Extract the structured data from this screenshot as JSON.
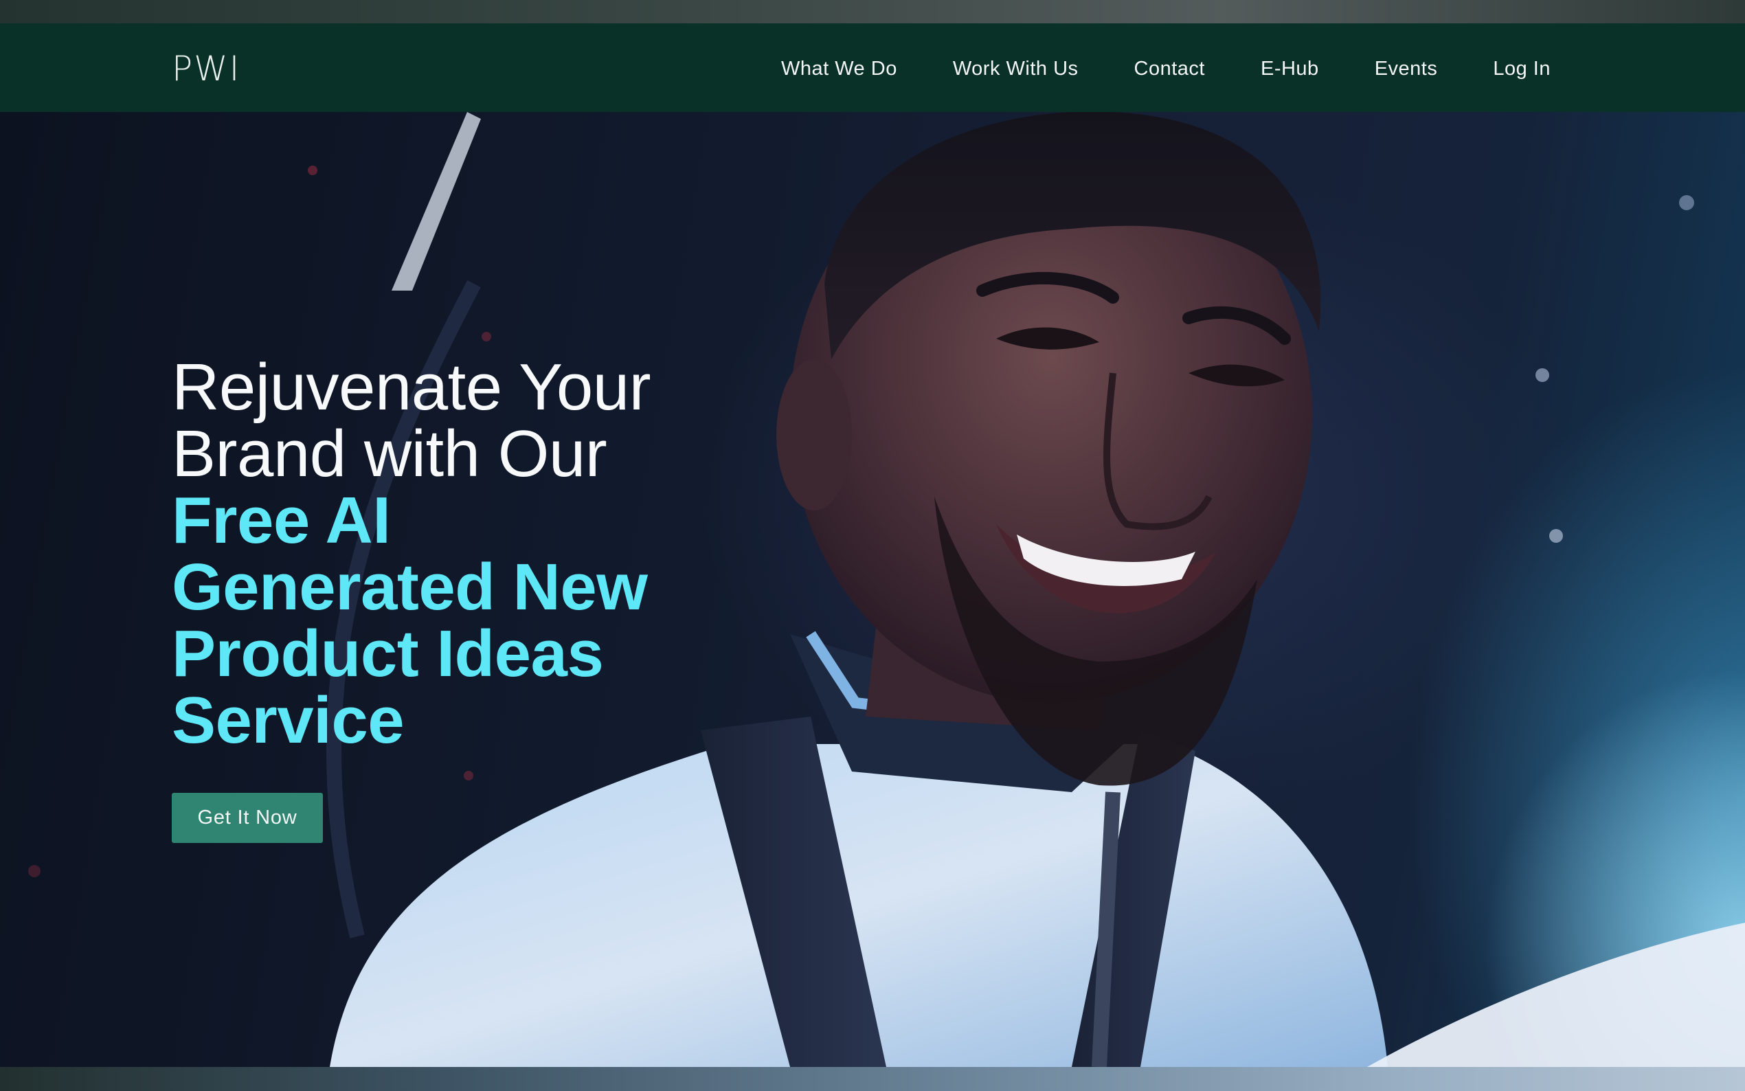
{
  "brand": {
    "logo_text": "PWI"
  },
  "nav": {
    "items": [
      {
        "label": "What We Do"
      },
      {
        "label": "Work With Us"
      },
      {
        "label": "Contact"
      },
      {
        "label": "E-Hub"
      },
      {
        "label": "Events"
      },
      {
        "label": "Log In"
      }
    ]
  },
  "hero": {
    "headline_white": [
      "Rejuvenate Your",
      "Brand with Our"
    ],
    "headline_cyan": [
      "Free AI",
      "Generated New",
      "Product Ideas",
      "Service"
    ],
    "cta_label": "Get It Now",
    "image_description_icon": "hero-portrait-image"
  },
  "colors": {
    "nav_background": "#0a3127",
    "accent_cyan": "#5ee7f7",
    "cta_background": "#2f8571",
    "hero_background": "#111a2c"
  }
}
